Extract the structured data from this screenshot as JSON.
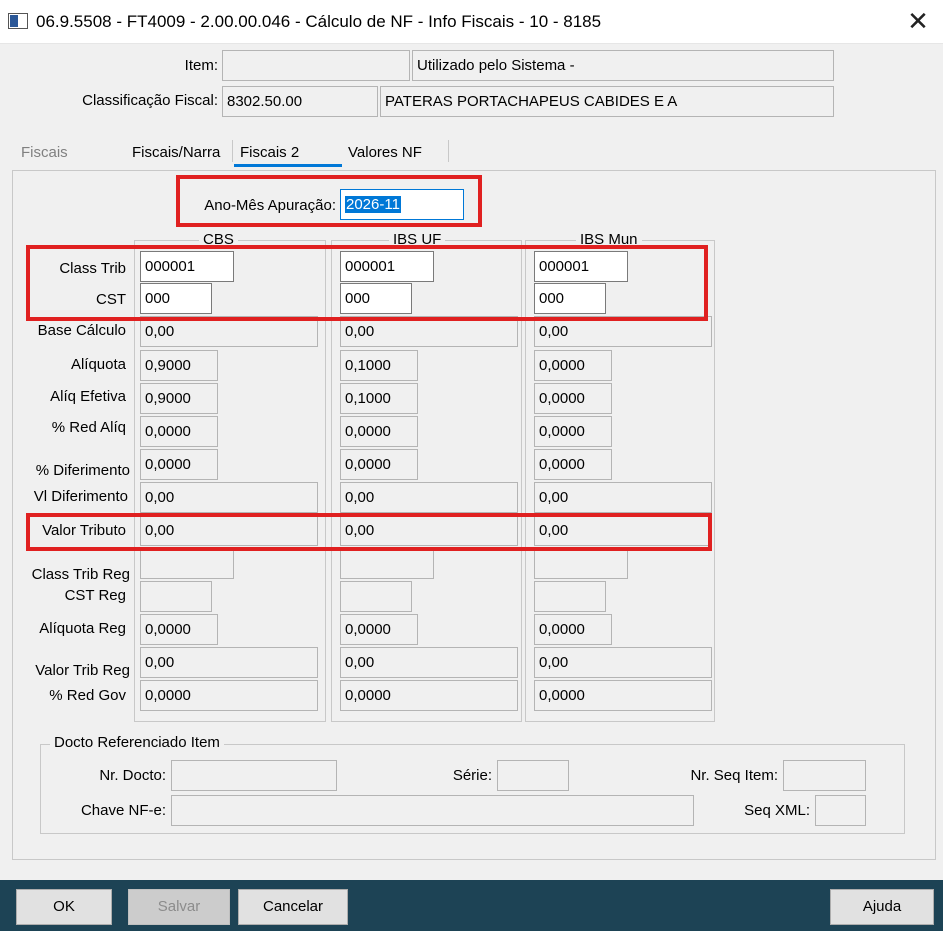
{
  "window": {
    "title": "06.9.5508 - FT4009 - 2.00.00.046 - Cálculo de NF - Info Fiscais - 10 - 8185"
  },
  "header": {
    "item_label": "Item:",
    "item_value": "",
    "item_desc": "Utilizado pelo Sistema -",
    "class_label": "Classificação Fiscal:",
    "class_value": "8302.50.00",
    "class_desc": "PATERAS PORTACHAPEUS CABIDES E A"
  },
  "tabs": [
    "Fiscais",
    "Fiscais/Narra",
    "Fiscais 2",
    "Valores NF"
  ],
  "active_tab": "Fiscais 2",
  "apuracao": {
    "label": "Ano-Mês Apuração:",
    "value": "2026-11"
  },
  "columns": [
    "CBS",
    "IBS UF",
    "IBS Mun"
  ],
  "row_labels": {
    "class_trib": "Class Trib",
    "cst": "CST",
    "base": "Base Cálculo",
    "aliq": "Alíquota",
    "aliq_ef": "Alíq Efetiva",
    "red_aliq": "% Red Alíq",
    "dif": "% Diferimento",
    "vl_dif": "Vl Diferimento",
    "vt": "Valor Tributo",
    "ct_reg": "Class Trib Reg",
    "cst_reg": "CST Reg",
    "aliq_reg": "Alíquota Reg",
    "vt_reg": "Valor Trib Reg",
    "red_gov": "% Red Gov"
  },
  "values": {
    "cbs": {
      "class_trib": "000001",
      "cst": "000",
      "base": "0,00",
      "aliq": "0,9000",
      "aliq_ef": "0,9000",
      "red_aliq": "0,0000",
      "dif": "0,0000",
      "vl_dif": "0,00",
      "vt": "0,00",
      "ct_reg": "",
      "cst_reg": "",
      "aliq_reg": "0,0000",
      "vt_reg": "0,00",
      "red_gov": "0,0000"
    },
    "ibs_uf": {
      "class_trib": "000001",
      "cst": "000",
      "base": "0,00",
      "aliq": "0,1000",
      "aliq_ef": "0,1000",
      "red_aliq": "0,0000",
      "dif": "0,0000",
      "vl_dif": "0,00",
      "vt": "0,00",
      "ct_reg": "",
      "cst_reg": "",
      "aliq_reg": "0,0000",
      "vt_reg": "0,00",
      "red_gov": "0,0000"
    },
    "ibs_mun": {
      "class_trib": "000001",
      "cst": "000",
      "base": "0,00",
      "aliq": "0,0000",
      "aliq_ef": "0,0000",
      "red_aliq": "0,0000",
      "dif": "0,0000",
      "vl_dif": "0,00",
      "vt": "0,00",
      "ct_reg": "",
      "cst_reg": "",
      "aliq_reg": "0,0000",
      "vt_reg": "0,00",
      "red_gov": "0,0000"
    }
  },
  "docto": {
    "title": "Docto Referenciado Item",
    "nr_docto_label": "Nr. Docto:",
    "nr_docto": "",
    "serie_label": "Série:",
    "serie": "",
    "nr_seq_label": "Nr. Seq Item:",
    "nr_seq": "",
    "chave_label": "Chave NF-e:",
    "chave": "",
    "seq_xml_label": "Seq XML:",
    "seq_xml": ""
  },
  "buttons": {
    "ok": "OK",
    "salvar": "Salvar",
    "cancelar": "Cancelar",
    "ajuda": "Ajuda"
  },
  "colors": {
    "highlight": "#e02020",
    "accent": "#0078d7",
    "footer": "#1d4355"
  }
}
